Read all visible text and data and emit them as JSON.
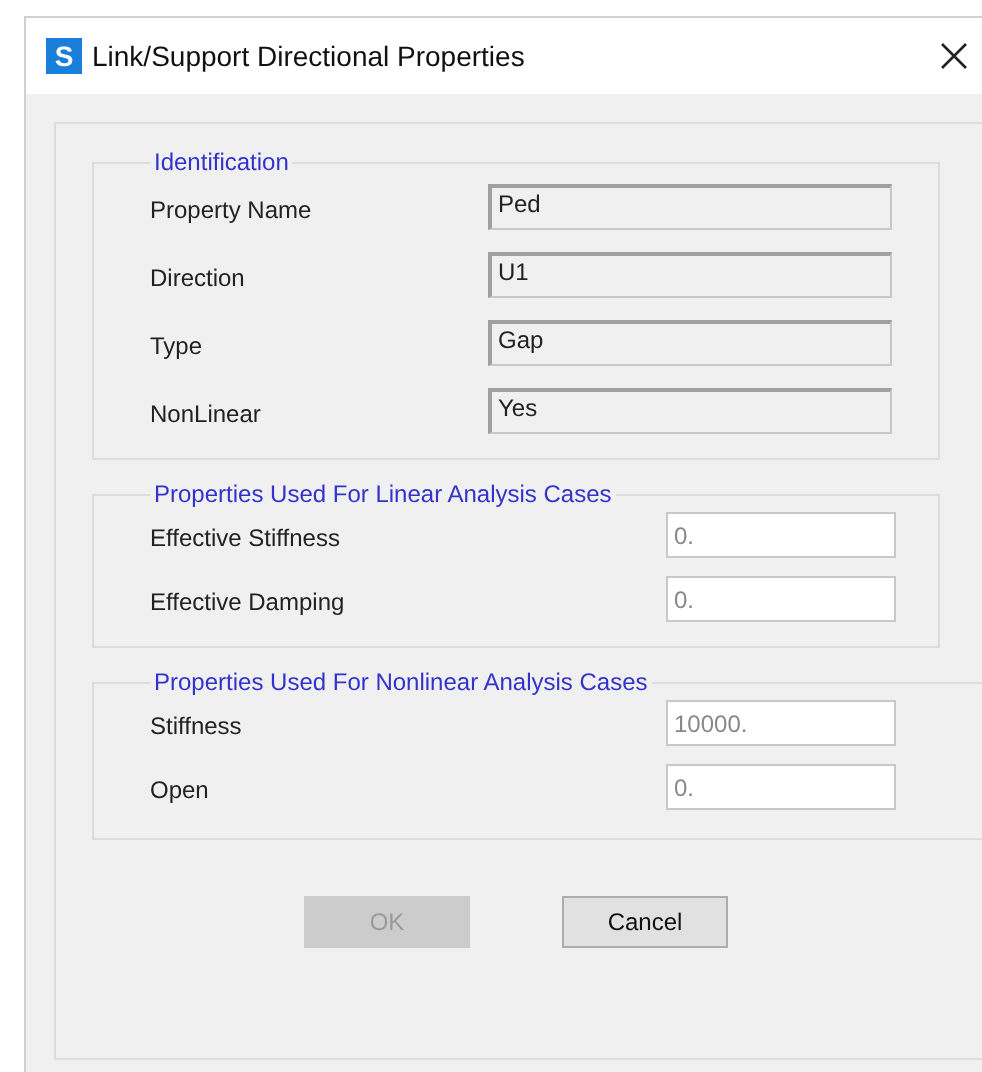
{
  "window": {
    "title": "Link/Support Directional Properties",
    "app_icon": "S"
  },
  "groups": [
    {
      "title": "Identification",
      "kind": "readonly",
      "rows": [
        {
          "label": "Property Name",
          "value": "Ped"
        },
        {
          "label": "Direction",
          "value": "U1"
        },
        {
          "label": "Type",
          "value": "Gap"
        },
        {
          "label": "NonLinear",
          "value": "Yes"
        }
      ]
    },
    {
      "title": "Properties Used For Linear Analysis Cases",
      "kind": "edit",
      "rows": [
        {
          "label": "Effective Stiffness",
          "value": "0."
        },
        {
          "label": "Effective Damping",
          "value": "0."
        }
      ]
    },
    {
      "title": "Properties Used For Nonlinear Analysis Cases",
      "kind": "edit",
      "rows": [
        {
          "label": "Stiffness",
          "value": "10000."
        },
        {
          "label": "Open",
          "value": "0."
        }
      ]
    }
  ],
  "buttons": [
    {
      "label": "OK",
      "disabled": true
    },
    {
      "label": "Cancel",
      "disabled": false
    }
  ]
}
